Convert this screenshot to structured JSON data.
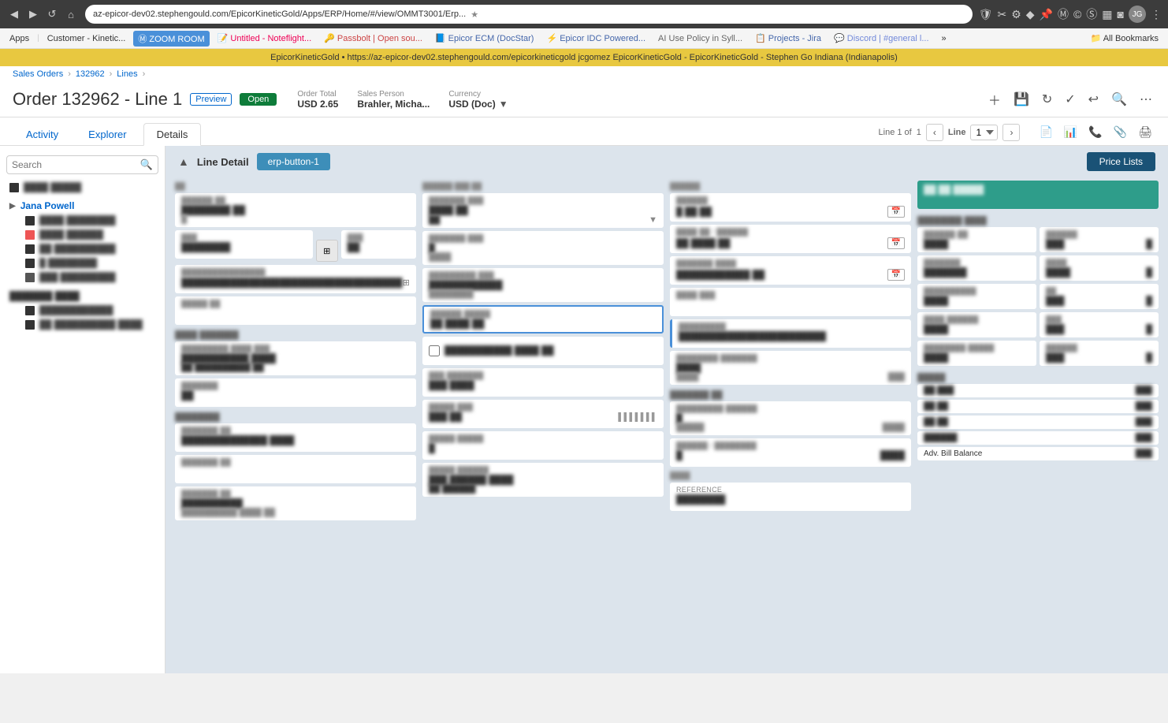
{
  "browser": {
    "url": "az-epicor-dev02.stephengould.com/EpicorKineticGold/Apps/ERP/Home/#/view/OMMT3001/Erp...",
    "back_btn": "◀",
    "forward_btn": "▶",
    "refresh_btn": "↺",
    "home_btn": "⌂"
  },
  "bookmarks": [
    {
      "label": "Apps"
    },
    {
      "label": "Customer - Kinetic..."
    },
    {
      "label": "ZOOM ROOM"
    },
    {
      "label": "Untitled - Noteflight..."
    },
    {
      "label": "Passbolt | Open sou..."
    },
    {
      "label": "Epicor ECM (DocStar)"
    },
    {
      "label": "Epicor IDC Powered..."
    },
    {
      "label": "AI Use Policy in Syll..."
    },
    {
      "label": "Projects - Jira"
    },
    {
      "label": "Discord | #general l..."
    },
    {
      "label": "»"
    },
    {
      "label": "All Bookmarks"
    }
  ],
  "notif_bar": {
    "text": "EpicorKineticGold   •   https://az-epicor-dev02.stephengould.com/epicorkineticgold   jcgomez   EpicorKineticGold - EpicorKineticGold - Stephen Go   Indiana (Indianapolis)"
  },
  "header": {
    "title": "Order 132962 - Line 1",
    "preview_label": "Preview",
    "status": "Open",
    "order_total_label": "Order Total",
    "order_total_value": "USD 2.65",
    "sales_person_label": "Sales Person",
    "sales_person_value": "Brahler, Micha...",
    "currency_label": "Currency",
    "currency_value": "USD (Doc)"
  },
  "breadcrumb": {
    "items": [
      "Sales Orders",
      "132962",
      "Lines"
    ]
  },
  "tabs": {
    "activity": "Activity",
    "explorer": "Explorer",
    "details": "Details"
  },
  "line_nav": {
    "label": "Line 1 of 1",
    "select_label": "Line",
    "select_value": "1"
  },
  "secondary_toolbar": {
    "icons": [
      "📄",
      "📊",
      "📞",
      "📎",
      "🖨️"
    ]
  },
  "sidebar": {
    "search_placeholder": "Search",
    "groups": [
      {
        "label": "████ █████",
        "items": []
      },
      {
        "label": "Jana Powell",
        "expanded": true,
        "items": [
          "████ █████████",
          "████ ██████",
          "██ ██████████",
          "█ ████████",
          "███████████"
        ]
      },
      {
        "label": "███████ ████",
        "items": [
          "████████████",
          "██ ██████████ ████"
        ]
      }
    ]
  },
  "main": {
    "section_title": "Line Detail",
    "erp_button": "erp-button-1",
    "price_lists_button": "Price Lists",
    "col1": {
      "section": "",
      "fields": [
        {
          "label": "Part/Rev",
          "value": "████████ ██"
        },
        {
          "label": "Description",
          "value": ""
        },
        {
          "label": "Reference / Rev",
          "value": "███████████████████████████████"
        },
        {
          "label": "Note",
          "value": ""
        },
        {
          "sub_section": "Unit Details"
        },
        {
          "label": "Customer Part Num",
          "value": "███████████ ████"
        },
        {
          "label": "UOM",
          "value": "██"
        },
        {
          "label": "Taxable",
          "value": ""
        },
        {
          "sub_section": "Comments"
        },
        {
          "label": "Comment 1",
          "value": ""
        },
        {
          "label": "Comment 2",
          "value": ""
        },
        {
          "label": "Comment 3",
          "value": ""
        }
      ]
    },
    "col2": {
      "fields": [
        {
          "label": "Ordered Qty / UOM",
          "value": "████ ██"
        },
        {
          "label": "Shipped Qty",
          "value": ""
        },
        {
          "label": "Remaining Qty",
          "value": ""
        },
        {
          "label": "Unit Price",
          "value": "██ ████ ██",
          "highlighted": true
        },
        {
          "label": "checkbox field",
          "value": ""
        },
        {
          "label": "Ext Amount",
          "value": "███ ████"
        },
        {
          "label": "Discount Amount",
          "value": ""
        },
        {
          "label": "Price Break",
          "value": ""
        },
        {
          "label": "Price Group",
          "value": "███ ██████ ████"
        }
      ]
    },
    "col3": {
      "fields": [
        {
          "label": "Status",
          "value": ""
        },
        {
          "label": "Need By / Latest",
          "value": ""
        },
        {
          "label": "Promise Date",
          "value": ""
        },
        {
          "label": "Ship Via",
          "value": ""
        },
        {
          "label": "Warehouse",
          "value": ""
        },
        {
          "label": "Plant",
          "value": ""
        },
        {
          "label": "Demand Link",
          "value": "██████████████████████"
        },
        {
          "label": "Purchase Linked",
          "value": ""
        },
        {
          "sub_section": "Qty"
        },
        {
          "label": "Ordered / Reserved",
          "value": ""
        },
        {
          "label": "Shipped / Remaining",
          "value": ""
        },
        {
          "label": "Reference",
          "value": ""
        }
      ]
    },
    "col4": {
      "section_teal": "██ ██ █████",
      "sub_section": "████████ ████",
      "fields_right": [
        {
          "label": "field 1a",
          "value": "",
          "label2": "field 1b",
          "value2": ""
        },
        {
          "label": "field 2a",
          "value": "",
          "label2": "field 2b",
          "value2": ""
        },
        {
          "label": "field 3a",
          "value": "",
          "label2": "field 3b",
          "value2": ""
        },
        {
          "label": "field 4a",
          "value": "",
          "label2": "field 4b",
          "value2": ""
        },
        {
          "label": "field 5a",
          "value": "",
          "label2": "field 5b",
          "value2": ""
        }
      ],
      "sub_section2": "█████",
      "fields_right2": [
        {
          "label": "field r1",
          "value": "",
          "suffix": ""
        },
        {
          "label": "field r2",
          "value": "",
          "suffix": ""
        },
        {
          "label": "field r3",
          "value": "",
          "suffix": ""
        },
        {
          "label": "field r4",
          "value": "",
          "suffix": ""
        },
        {
          "label": "Adv. Bill Balance",
          "value": ""
        }
      ]
    }
  }
}
